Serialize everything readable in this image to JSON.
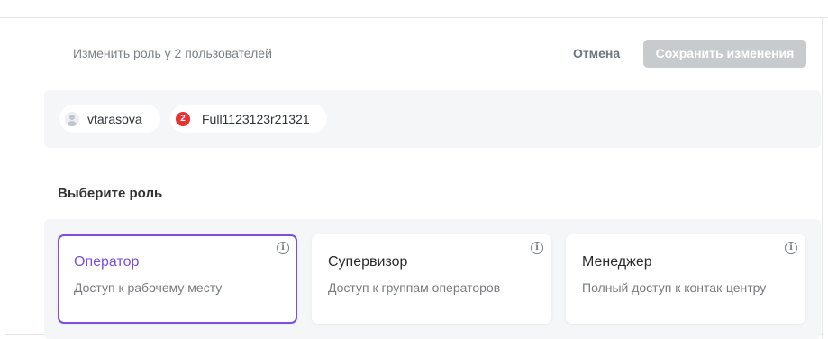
{
  "header": {
    "title": "Изменить роль у 2 пользователей",
    "cancel_label": "Отмена",
    "save_label": "Сохранить изменения"
  },
  "users": [
    {
      "name": "vtarasova",
      "icon": "avatar-placeholder-icon"
    },
    {
      "name": "Full1123123r21321",
      "badge": "2"
    }
  ],
  "roles_section": {
    "title": "Выберите роль",
    "selected": "Оператор",
    "accent_color": "#7b4fe0",
    "roles": [
      {
        "name": "Оператор",
        "description": "Доступ к рабочему месту",
        "icon": "info-icon"
      },
      {
        "name": "Супервизор",
        "description": "Доступ к группам операторов",
        "icon": "info-icon"
      },
      {
        "name": "Менеджер",
        "description": "Полный доступ к контак-центру",
        "icon": "info-icon"
      }
    ]
  },
  "colors": {
    "badge": "#e53232",
    "save_button_disabled": "#c8cbce",
    "panel_bg": "#f5f6f7"
  }
}
